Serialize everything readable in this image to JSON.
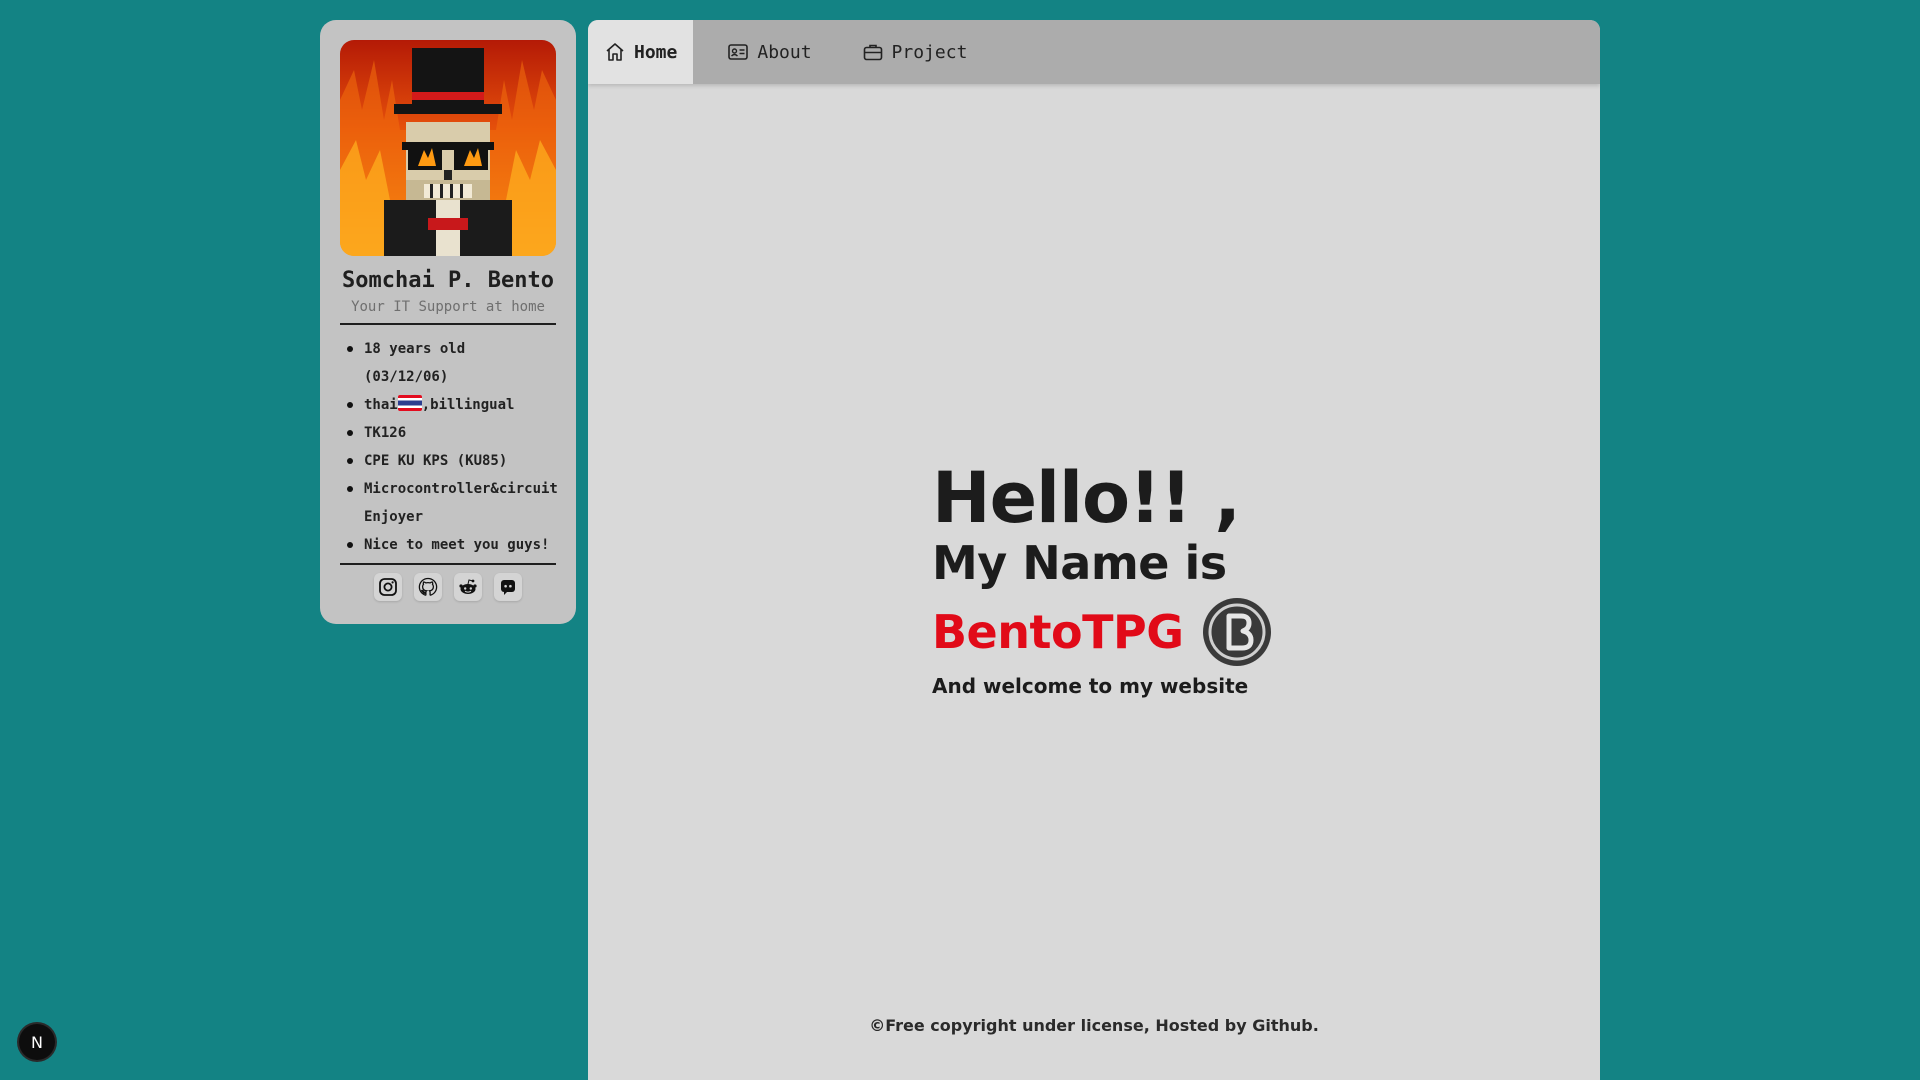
{
  "profile": {
    "name": "Somchai P. Bento",
    "subtitle": "Your IT Support at home",
    "facts": [
      "18 years old (03/12/06)",
      "thai",
      "TK126",
      "CPE KU KPS (KU85)",
      "Microcontroller&circuit Enjoyer",
      "Nice to meet you guys!"
    ],
    "fact_thai_suffix": ",billingual",
    "social_icons": [
      "instagram-icon",
      "github-icon",
      "reddit-icon",
      "discord-icon"
    ]
  },
  "nav": {
    "tabs": [
      {
        "label": "Home",
        "icon": "home-icon",
        "active": true
      },
      {
        "label": "About",
        "icon": "id-card-icon",
        "active": false
      },
      {
        "label": "Project",
        "icon": "briefcase-icon",
        "active": false
      }
    ]
  },
  "hero": {
    "hello": "Hello!! ,",
    "my_name_is": "My Name is",
    "brand": "BentoTPG",
    "welcome": "And welcome to my website"
  },
  "footer": {
    "text": "©Free copyright under license, Hosted by Github."
  },
  "badge": {
    "letter": "N"
  },
  "colors": {
    "background": "#138384",
    "brand_red": "#e10a18",
    "panel": "#d9d9d9",
    "nav": "#acacac",
    "card": "#c3c3c3"
  }
}
